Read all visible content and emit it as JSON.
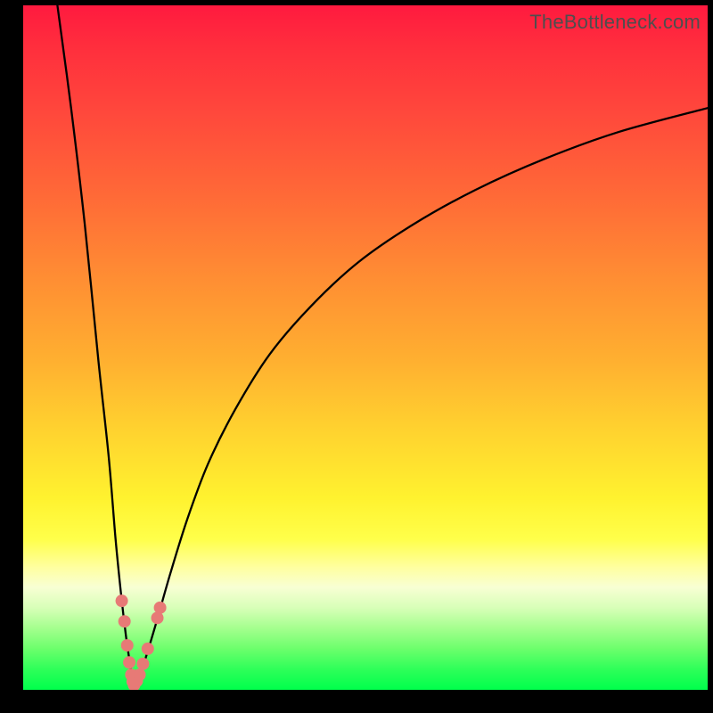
{
  "watermark": "TheBottleneck.com",
  "chart_data": {
    "type": "line",
    "title": "",
    "xlabel": "",
    "ylabel": "",
    "xlim": [
      0,
      100
    ],
    "ylim": [
      0,
      100
    ],
    "grid": false,
    "legend": false,
    "background_gradient": [
      "#ff1a3f",
      "#ff8e33",
      "#ffff4a",
      "#00ff4c"
    ],
    "series": [
      {
        "name": "left-branch",
        "x": [
          5,
          7,
          9,
          11,
          12.5,
          13.5,
          14.3,
          15,
          15.5,
          15.8,
          16,
          16.2
        ],
        "values": [
          100,
          85,
          68,
          48,
          34,
          22,
          14,
          8,
          4.5,
          2.5,
          1.3,
          0.6
        ]
      },
      {
        "name": "right-branch",
        "x": [
          16.2,
          17,
          18,
          19.5,
          21.5,
          24,
          27,
          31,
          36,
          42,
          49,
          57,
          66,
          76,
          87,
          100
        ],
        "values": [
          0.6,
          2,
          5,
          10,
          17,
          25,
          33,
          41,
          49,
          56,
          62.5,
          68,
          73,
          77.5,
          81.5,
          85
        ]
      }
    ],
    "markers": {
      "name": "cluster",
      "color": "#e77a76",
      "radius_px": 7,
      "points": [
        {
          "x": 14.4,
          "y": 13.0
        },
        {
          "x": 14.8,
          "y": 10.0
        },
        {
          "x": 15.2,
          "y": 6.5
        },
        {
          "x": 15.5,
          "y": 4.0
        },
        {
          "x": 15.8,
          "y": 2.2
        },
        {
          "x": 16.0,
          "y": 1.2
        },
        {
          "x": 16.2,
          "y": 0.7
        },
        {
          "x": 16.6,
          "y": 1.3
        },
        {
          "x": 17.0,
          "y": 2.2
        },
        {
          "x": 17.5,
          "y": 3.8
        },
        {
          "x": 18.2,
          "y": 6.0
        },
        {
          "x": 19.6,
          "y": 10.5
        },
        {
          "x": 20.0,
          "y": 12.0
        }
      ]
    }
  }
}
